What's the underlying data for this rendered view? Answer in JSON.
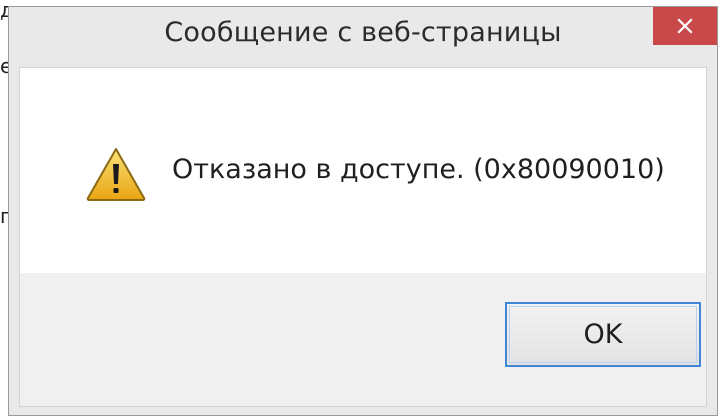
{
  "dialog": {
    "title": "Сообщение с веб-страницы",
    "message": "Отказано в доступе. (0x80090010)",
    "ok_label": "OK"
  },
  "icons": {
    "close": "close-icon",
    "warning": "warning-icon"
  },
  "colors": {
    "close_button": "#c9484a",
    "ok_border": "#3e87d6",
    "warning_fill": "#f2c230"
  }
}
